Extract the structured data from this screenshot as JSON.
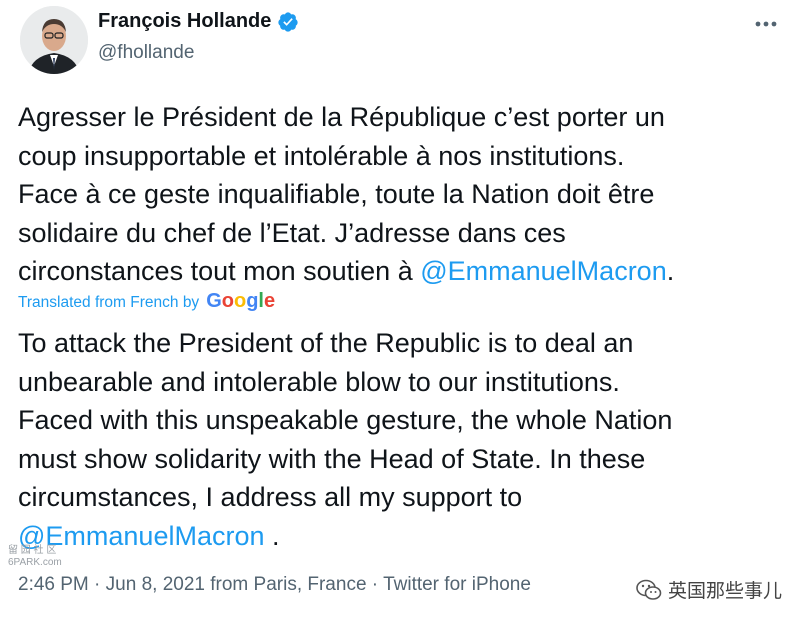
{
  "author": {
    "display_name": "François Hollande",
    "handle": "@fhollande"
  },
  "tweet": {
    "original_lines": [
      "Agresser le Président de la République c’est porter un",
      "coup insupportable et intolérable à nos institutions.",
      "Face à ce geste inqualifiable, toute la Nation doit être",
      "solidaire du chef de l’Etat. J’adresse dans ces"
    ],
    "original_last_prefix": "circonstances tout mon soutien à ",
    "original_mention": "@EmmanuelMacron",
    "original_last_suffix": ".",
    "translated_label": "Translated from French by",
    "translation_lines": [
      "To attack the President of the Republic is to deal an",
      "unbearable and intolerable blow to our institutions.",
      "Faced with this unspeakable gesture, the whole Nation",
      "must show solidarity with the Head of State. In these",
      "circumstances, I address all my support to"
    ],
    "translation_mention": "@EmmanuelMacron",
    "translation_suffix": " ."
  },
  "meta": {
    "time": "2:46 PM",
    "date": "Jun 8, 2021",
    "location": "from Paris, France",
    "source": "Twitter for iPhone",
    "separator": "·"
  },
  "watermark": {
    "small_line1": "留 园 社 区",
    "small_line2": "6PARK.com",
    "right_text": "英国那些事儿"
  },
  "icons": {
    "verified": "verified-badge-icon",
    "more": "more-options-icon",
    "watermark": "wechat-logo-icon"
  },
  "colors": {
    "accent": "#1d9bf0",
    "secondary_text": "#536471",
    "primary_text": "#0f1419"
  }
}
